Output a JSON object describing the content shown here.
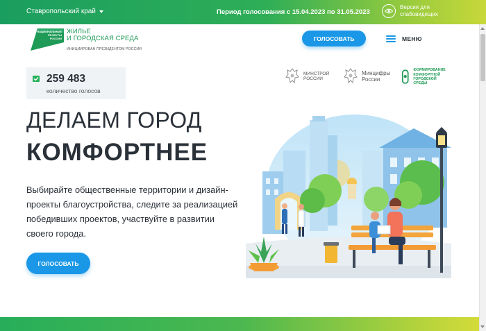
{
  "topbar": {
    "region": "Ставропольский край",
    "period": "Период голосования с 15.04.2023 по 31.05.2023",
    "vision_line1": "Версия для",
    "vision_line2": "слабовидящих"
  },
  "logo": {
    "mark_text": [
      "НАЦИОНАЛЬНЫЕ",
      "ПРОЕКТЫ",
      "РОССИИ"
    ],
    "title_line1": "ЖИЛЬЕ",
    "title_line2": "И ГОРОДСКАЯ СРЕДА",
    "subtitle": "ИНИЦИИРОВАН ПРЕЗИДЕНТОМ РОССИИ"
  },
  "header": {
    "vote_button": "ГОЛОСОВАТЬ",
    "menu_label": "МЕНЮ"
  },
  "votes": {
    "count": "259 483",
    "caption": "количество голосов"
  },
  "partners": {
    "minstroy": [
      "МИНСТРОЙ",
      "РОССИИ"
    ],
    "mincifry": [
      "Минцифры",
      "России"
    ],
    "formirovanie": [
      "ФОРМИРОВАНИЕ",
      "КОМФОРТНОЙ",
      "ГОРОДСКОЙ СРЕДЫ"
    ]
  },
  "hero": {
    "title_line1": "ДЕЛАЕМ ГОРОД",
    "title_line2": "КОМФОРТНЕЕ",
    "description": "Выбирайте общественные территории и дизайн-проекты благоустройства, следите за реализацией победивших проектов, участвуйте в развитии своего города.",
    "vote_button": "ГОЛОСОВАТЬ"
  },
  "colors": {
    "brand_green": "#1f9a57",
    "accent_blue": "#1a97e6",
    "text_dark": "#2a3038"
  },
  "icons": {
    "region_caret": "chevron-down-icon",
    "vision": "eye-icon",
    "menu": "hamburger-icon",
    "vote_check": "checkmark-icon"
  }
}
